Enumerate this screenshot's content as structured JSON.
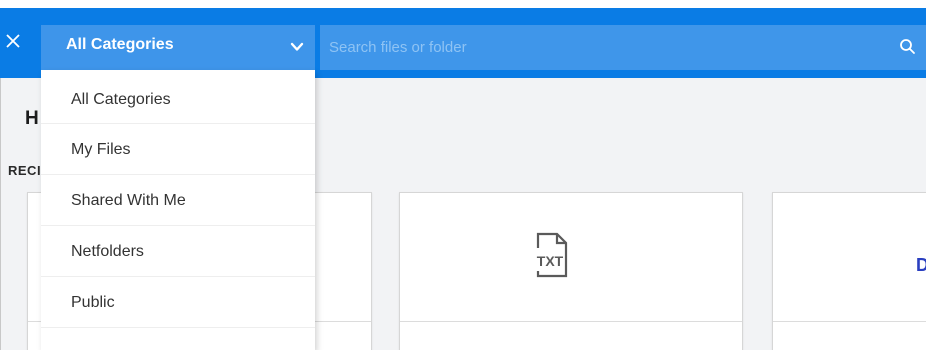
{
  "header": {
    "category_select": {
      "selected": "All Categories"
    },
    "search": {
      "placeholder": "Search files or folder",
      "value": ""
    }
  },
  "category_menu": {
    "items": [
      {
        "label": "All Categories"
      },
      {
        "label": "My Files"
      },
      {
        "label": "Shared With Me"
      },
      {
        "label": "Netfolders"
      },
      {
        "label": "Public"
      }
    ]
  },
  "main": {
    "title": "H",
    "section_label": "RECI",
    "cards": [
      {
        "icon": "blank-file-icon"
      },
      {
        "icon": "txt-file-icon",
        "badge": "TXT"
      },
      {
        "icon": "doc-file-icon",
        "glyph": "D"
      }
    ]
  },
  "colors": {
    "header_bg": "#0a7ce5",
    "select_bg": "#3e95ea",
    "page_bg": "#f2f3f5",
    "doc_glyph": "#2a3fc0"
  }
}
